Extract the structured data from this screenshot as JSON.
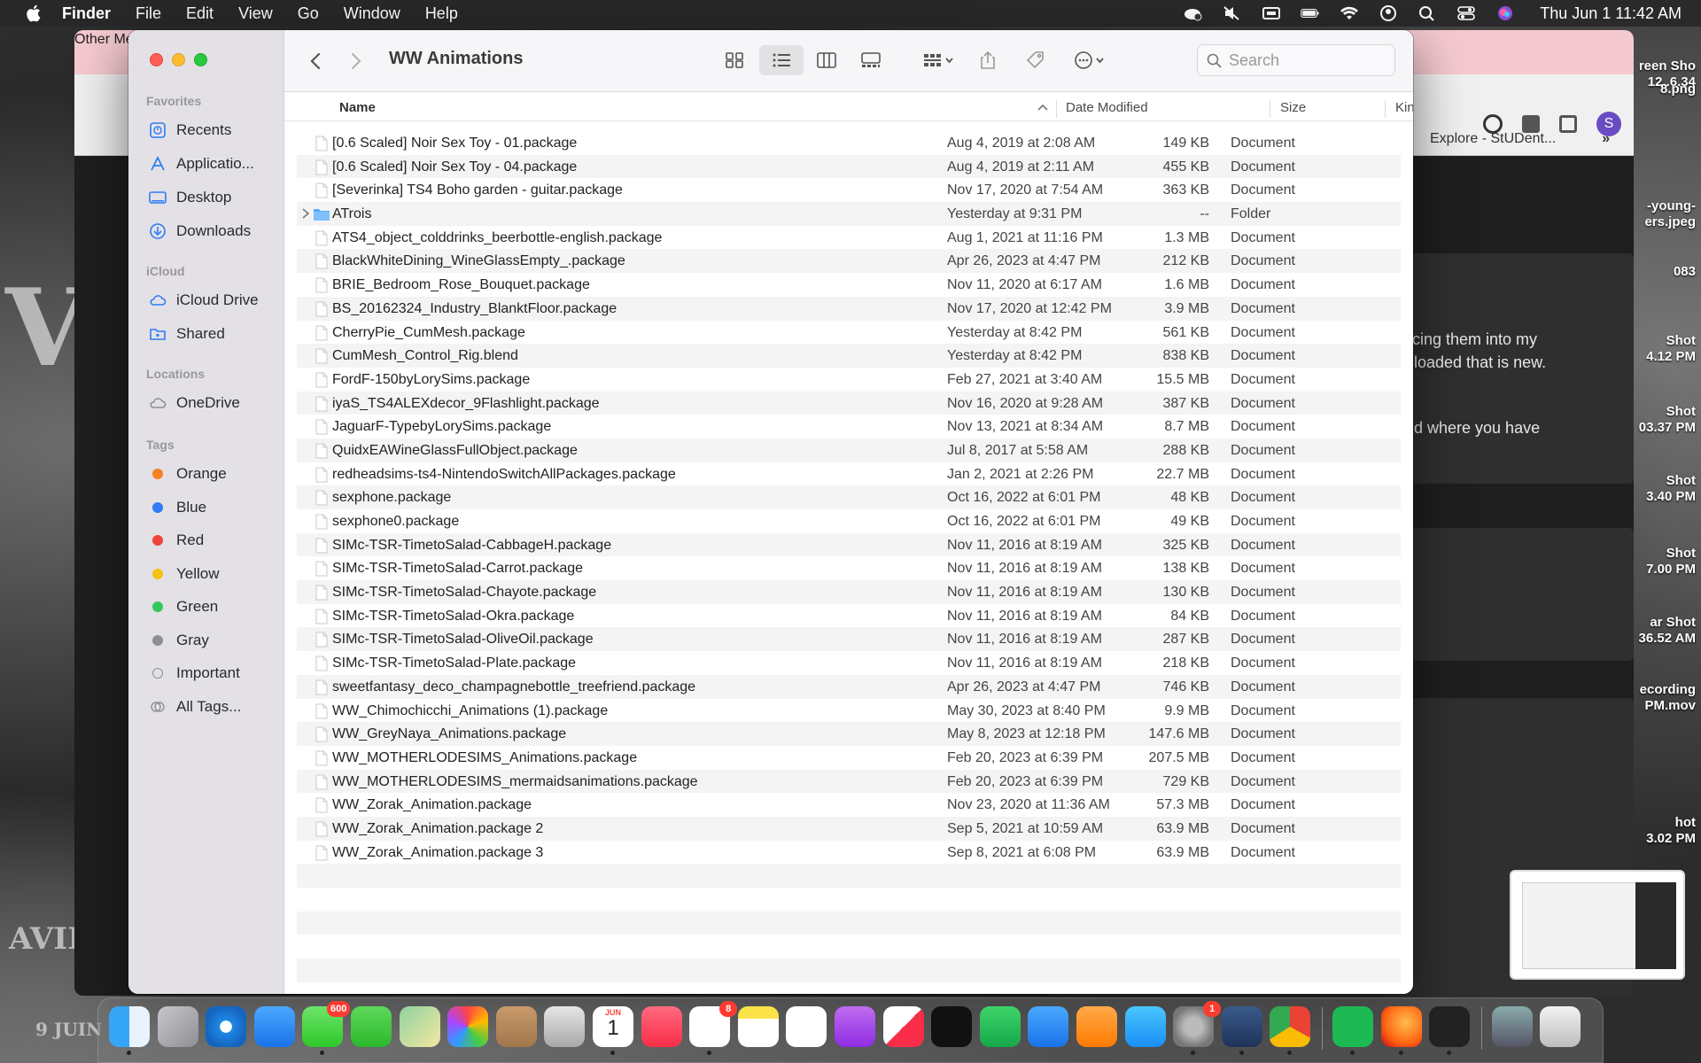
{
  "menubar": {
    "app": "Finder",
    "menus": [
      "File",
      "Edit",
      "View",
      "Go",
      "Window",
      "Help"
    ],
    "clock": "Thu Jun 1  11:42 AM"
  },
  "finder": {
    "title": "WW Animations",
    "search_placeholder": "Search",
    "sidebar": {
      "favorites_label": "Favorites",
      "favorites": [
        {
          "label": "Recents",
          "icon": "clock-icon"
        },
        {
          "label": "Applicatio...",
          "icon": "applications-icon"
        },
        {
          "label": "Desktop",
          "icon": "desktop-icon"
        },
        {
          "label": "Downloads",
          "icon": "downloads-icon"
        }
      ],
      "icloud_label": "iCloud",
      "icloud": [
        {
          "label": "iCloud Drive",
          "icon": "cloud-icon"
        },
        {
          "label": "Shared",
          "icon": "shared-folder-icon"
        }
      ],
      "locations_label": "Locations",
      "locations": [
        {
          "label": "OneDrive",
          "icon": "cloud-icon"
        }
      ],
      "tags_label": "Tags",
      "tags": [
        {
          "label": "Orange",
          "color": "#f5811f"
        },
        {
          "label": "Blue",
          "color": "#2f7cf6"
        },
        {
          "label": "Red",
          "color": "#f0443a"
        },
        {
          "label": "Yellow",
          "color": "#f2c311"
        },
        {
          "label": "Green",
          "color": "#34c759"
        },
        {
          "label": "Gray",
          "color": "#8e8e93"
        },
        {
          "label": "Important",
          "color": "none"
        },
        {
          "label": "All Tags...",
          "color": "all"
        }
      ]
    },
    "columns": {
      "name": "Name",
      "date": "Date Modified",
      "size": "Size",
      "kind": "Kind"
    },
    "files": [
      {
        "name": "[0.6 Scaled] Noir Sex Toy - 01.package",
        "date": "Aug 4, 2019 at 2:08 AM",
        "size": "149 KB",
        "kind": "Document"
      },
      {
        "name": "[0.6 Scaled] Noir Sex Toy - 04.package",
        "date": "Aug 4, 2019 at 2:11 AM",
        "size": "455 KB",
        "kind": "Document"
      },
      {
        "name": "[Severinka] TS4 Boho garden - guitar.package",
        "date": "Nov 17, 2020 at 7:54 AM",
        "size": "363 KB",
        "kind": "Document"
      },
      {
        "name": "ATrois",
        "date": "Yesterday at 9:31 PM",
        "size": "--",
        "kind": "Folder",
        "folder": true
      },
      {
        "name": "ATS4_object_colddrinks_beerbottle-english.package",
        "date": "Aug 1, 2021 at 11:16 PM",
        "size": "1.3 MB",
        "kind": "Document"
      },
      {
        "name": "BlackWhiteDining_WineGlassEmpty_.package",
        "date": "Apr 26, 2023 at 4:47 PM",
        "size": "212 KB",
        "kind": "Document"
      },
      {
        "name": "BRIE_Bedroom_Rose_Bouquet.package",
        "date": "Nov 11, 2020 at 6:17 AM",
        "size": "1.6 MB",
        "kind": "Document"
      },
      {
        "name": "BS_20162324_Industry_BlanktFloor.package",
        "date": "Nov 17, 2020 at 12:42 PM",
        "size": "3.9 MB",
        "kind": "Document"
      },
      {
        "name": "CherryPie_CumMesh.package",
        "date": "Yesterday at 8:42 PM",
        "size": "561 KB",
        "kind": "Document"
      },
      {
        "name": "CumMesh_Control_Rig.blend",
        "date": "Yesterday at 8:42 PM",
        "size": "838 KB",
        "kind": "Document"
      },
      {
        "name": "FordF-150byLorySims.package",
        "date": "Feb 27, 2021 at 3:40 AM",
        "size": "15.5 MB",
        "kind": "Document"
      },
      {
        "name": "iyaS_TS4ALEXdecor_9Flashlight.package",
        "date": "Nov 16, 2020 at 9:28 AM",
        "size": "387 KB",
        "kind": "Document"
      },
      {
        "name": "JaguarF-TypebyLorySims.package",
        "date": "Nov 13, 2021 at 8:34 AM",
        "size": "8.7 MB",
        "kind": "Document"
      },
      {
        "name": "QuidxEAWineGlassFullObject.package",
        "date": "Jul 8, 2017 at 5:58 AM",
        "size": "288 KB",
        "kind": "Document"
      },
      {
        "name": "redheadsims-ts4-NintendoSwitchAllPackages.package",
        "date": "Jan 2, 2021 at 2:26 PM",
        "size": "22.7 MB",
        "kind": "Document"
      },
      {
        "name": "sexphone.package",
        "date": "Oct 16, 2022 at 6:01 PM",
        "size": "48 KB",
        "kind": "Document"
      },
      {
        "name": "sexphone0.package",
        "date": "Oct 16, 2022 at 6:01 PM",
        "size": "49 KB",
        "kind": "Document"
      },
      {
        "name": "SIMc-TSR-TimetoSalad-CabbageH.package",
        "date": "Nov 11, 2016 at 8:19 AM",
        "size": "325 KB",
        "kind": "Document"
      },
      {
        "name": "SIMc-TSR-TimetoSalad-Carrot.package",
        "date": "Nov 11, 2016 at 8:19 AM",
        "size": "138 KB",
        "kind": "Document"
      },
      {
        "name": "SIMc-TSR-TimetoSalad-Chayote.package",
        "date": "Nov 11, 2016 at 8:19 AM",
        "size": "130 KB",
        "kind": "Document"
      },
      {
        "name": "SIMc-TSR-TimetoSalad-Okra.package",
        "date": "Nov 11, 2016 at 8:19 AM",
        "size": "84 KB",
        "kind": "Document"
      },
      {
        "name": "SIMc-TSR-TimetoSalad-OliveOil.package",
        "date": "Nov 11, 2016 at 8:19 AM",
        "size": "287 KB",
        "kind": "Document"
      },
      {
        "name": "SIMc-TSR-TimetoSalad-Plate.package",
        "date": "Nov 11, 2016 at 8:19 AM",
        "size": "218 KB",
        "kind": "Document"
      },
      {
        "name": "sweetfantasy_deco_champagnebottle_treefriend.package",
        "date": "Apr 26, 2023 at 4:47 PM",
        "size": "746 KB",
        "kind": "Document"
      },
      {
        "name": "WW_Chimochicchi_Animations (1).package",
        "date": "May 30, 2023 at 8:40 PM",
        "size": "9.9 MB",
        "kind": "Document"
      },
      {
        "name": "WW_GreyNaya_Animations.package",
        "date": "May 8, 2023 at 12:18 PM",
        "size": "147.6 MB",
        "kind": "Document"
      },
      {
        "name": "WW_MOTHERLODESIMS_Animations.package",
        "date": "Feb 20, 2023 at 6:39 PM",
        "size": "207.5 MB",
        "kind": "Document"
      },
      {
        "name": "WW_MOTHERLODESIMS_mermaidsanimations.package",
        "date": "Feb 20, 2023 at 6:39 PM",
        "size": "729 KB",
        "kind": "Document"
      },
      {
        "name": "WW_Zorak_Animation.package",
        "date": "Nov 23, 2020 at 11:36 AM",
        "size": "57.3 MB",
        "kind": "Document"
      },
      {
        "name": "WW_Zorak_Animation.package 2",
        "date": "Sep 5, 2021 at 10:59 AM",
        "size": "63.9 MB",
        "kind": "Document"
      },
      {
        "name": "WW_Zorak_Animation.package 3",
        "date": "Sep 8, 2021 at 6:08 PM",
        "size": "63.9 MB",
        "kind": "Document"
      }
    ]
  },
  "browser": {
    "bookmark_right": "Explore - StUDent...",
    "page_text_1": "cing them into my",
    "page_text_2": "loaded that is new.",
    "page_text_3": "d where you have",
    "other_media": "Other Media ▾"
  },
  "desktop_files": [
    {
      "label": "reen Sho\n12..6.34"
    },
    {
      "label": "8.png"
    },
    {
      "label": "-young-\ners.jpeg"
    },
    {
      "label": "083"
    },
    {
      "label": "Shot\n4.12 PM"
    },
    {
      "label": "Shot\n03.37 PM"
    },
    {
      "label": "Shot\n3.40 PM"
    },
    {
      "label": "Shot\n7.00 PM"
    },
    {
      "label": "ar Shot\n36.52 AM"
    },
    {
      "label": "ecording\nPM.mov"
    },
    {
      "label": "hot\n3.02 PM"
    }
  ],
  "dock": {
    "badges": {
      "messages": "600",
      "calendar_month": "JUN",
      "calendar_day": "1",
      "reminders": "8",
      "settings": "1"
    }
  }
}
